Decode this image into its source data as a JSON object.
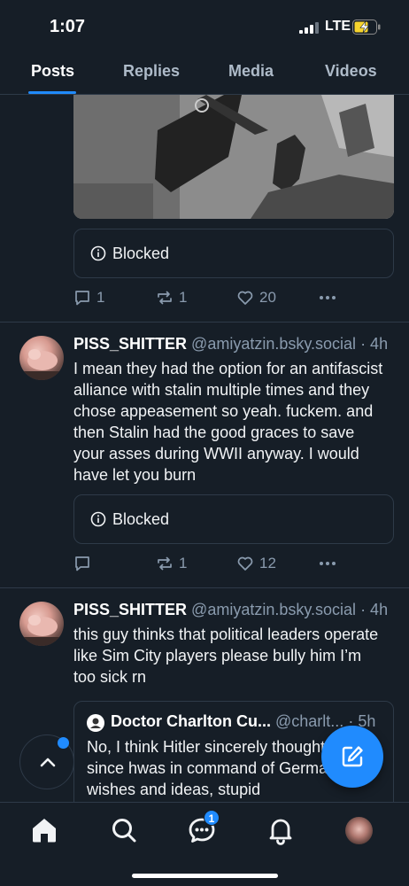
{
  "status_bar": {
    "time": "1:07",
    "network": "LTE"
  },
  "tabs": [
    {
      "label": "Posts",
      "active": true
    },
    {
      "label": "Replies",
      "active": false
    },
    {
      "label": "Media",
      "active": false
    },
    {
      "label": "Videos",
      "active": false
    }
  ],
  "posts": [
    {
      "embed_label": "Blocked",
      "replies": "1",
      "reposts": "1",
      "likes": "20"
    },
    {
      "author": "PISS_SHITTER",
      "handle": "@amiyatzin.bsky.social",
      "time": "· 4h",
      "body": "I mean they had the option for an antifascist alliance with stalin multiple times and they chose appeasement so yeah. fuckem. and then Stalin had the good graces to save your asses during WWII anyway. I would have let you burn",
      "embed_label": "Blocked",
      "replies": "",
      "reposts": "1",
      "likes": "12"
    },
    {
      "author": "PISS_SHITTER",
      "handle": "@amiyatzin.bsky.social",
      "time": "· 4h",
      "body": "this guy thinks that political leaders operate like Sim City players please bully him I’m too sick rn",
      "quote": {
        "author": "Doctor Charlton Cu...",
        "handle": "@charlt...",
        "time": "· 5h",
        "body": "No, I think Hitler sincerely thought and since hwas in command of Germany, his wishes and ideas, stupid"
      }
    }
  ],
  "nav": {
    "chat_badge": "1"
  },
  "colors": {
    "background": "#161e27",
    "accent": "#208bfe",
    "divider": "#2e3a48",
    "muted": "#8a9bae"
  }
}
